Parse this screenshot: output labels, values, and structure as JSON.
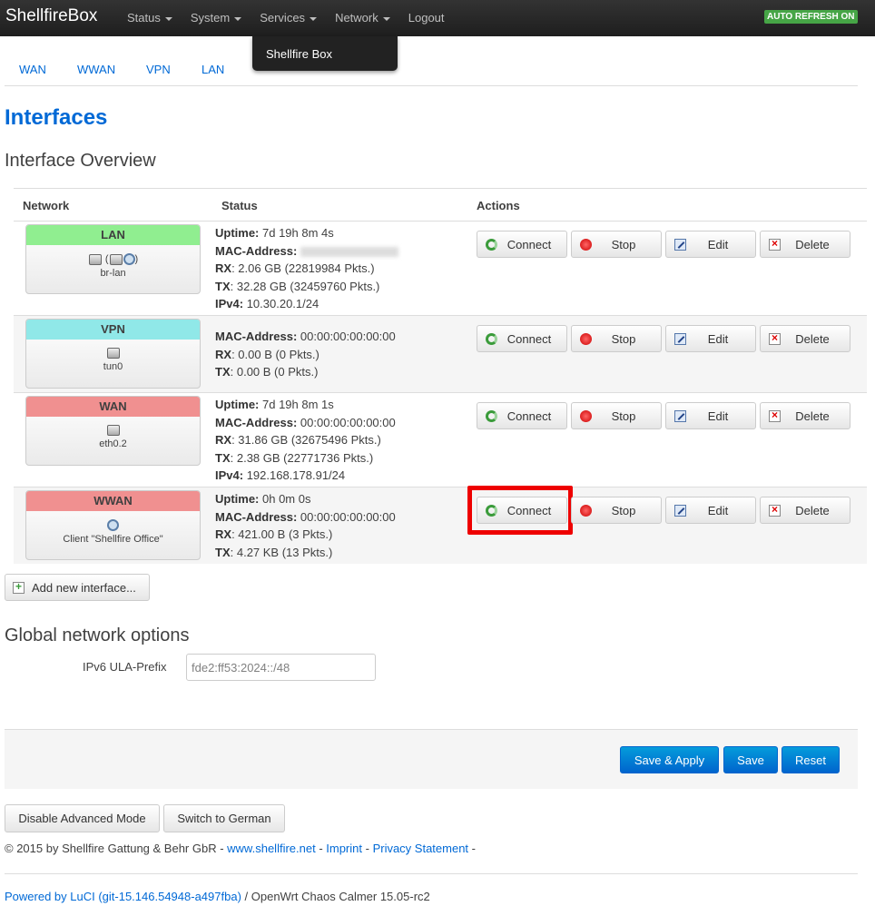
{
  "navbar": {
    "brand": "ShellfireBox",
    "menu": [
      "Status",
      "System",
      "Services",
      "Network",
      "Logout"
    ],
    "auto_refresh": "AUTO REFRESH ON"
  },
  "dropdown": {
    "item": "Shellfire Box"
  },
  "subtabs": [
    "WAN",
    "WWAN",
    "VPN",
    "LAN"
  ],
  "page_title": "Interfaces",
  "overview_title": "Interface Overview",
  "table": {
    "headers": {
      "network": "Network",
      "status": "Status",
      "actions": "Actions"
    },
    "rows": [
      {
        "name": "LAN",
        "color": "#90ee90",
        "device": "br-lan",
        "lines": [
          {
            "label": "Uptime:",
            "value": " 7d 19h 8m 4s"
          },
          {
            "label": "MAC-Address:",
            "value": ""
          },
          {
            "label": "RX",
            "value": ": 2.06 GB (22819984 Pkts.)"
          },
          {
            "label": "TX",
            "value": ": 32.28 GB (32459760 Pkts.)"
          },
          {
            "label": "IPv4:",
            "value": " 10.30.20.1/24"
          }
        ]
      },
      {
        "name": "VPN",
        "color": "#90e8e8",
        "device": "tun0",
        "lines": [
          {
            "label": "MAC-Address:",
            "value": " 00:00:00:00:00:00"
          },
          {
            "label": "RX",
            "value": ": 0.00 B (0 Pkts.)"
          },
          {
            "label": "TX",
            "value": ": 0.00 B (0 Pkts.)"
          }
        ]
      },
      {
        "name": "WAN",
        "color": "#f09090",
        "device": "eth0.2",
        "lines": [
          {
            "label": "Uptime:",
            "value": " 7d 19h 8m 1s"
          },
          {
            "label": "MAC-Address:",
            "value": " 00:00:00:00:00:00"
          },
          {
            "label": "RX",
            "value": ": 31.86 GB (32675496 Pkts.)"
          },
          {
            "label": "TX",
            "value": ": 2.38 GB (22771736 Pkts.)"
          },
          {
            "label": "IPv4:",
            "value": " 192.168.178.91/24"
          }
        ]
      },
      {
        "name": "WWAN",
        "color": "#f09090",
        "device": "Client \"Shellfire Office\"",
        "lines": [
          {
            "label": "Uptime:",
            "value": " 0h 0m 0s"
          },
          {
            "label": "MAC-Address:",
            "value": " 00:00:00:00:00:00"
          },
          {
            "label": "RX",
            "value": ": 421.00 B (3 Pkts.)"
          },
          {
            "label": "TX",
            "value": ": 4.27 KB (13 Pkts.)"
          }
        ]
      }
    ],
    "buttons": {
      "connect": "Connect",
      "stop": "Stop",
      "edit": "Edit",
      "delete": "Delete"
    }
  },
  "add_interface": "Add new interface...",
  "global_title": "Global network options",
  "ula": {
    "label": "IPv6 ULA-Prefix",
    "value": "fde2:ff53:2024::/48"
  },
  "actions": {
    "save_apply": "Save & Apply",
    "save": "Save",
    "reset": "Reset"
  },
  "mode_buttons": {
    "advanced": "Disable Advanced Mode",
    "language": "Switch to German"
  },
  "footer": {
    "copyright": "© 2015 by Shellfire Gattung & Behr GbR - ",
    "website": "www.shellfire.net",
    "sep1": " - ",
    "imprint": "Imprint",
    "sep2": " - ",
    "privacy": "Privacy Statement",
    "sep3": " -"
  },
  "powered": {
    "link": "Powered by LuCI (git-15.146.54948-a497fba)",
    "text": " / OpenWrt Chaos Calmer 15.05-rc2"
  }
}
